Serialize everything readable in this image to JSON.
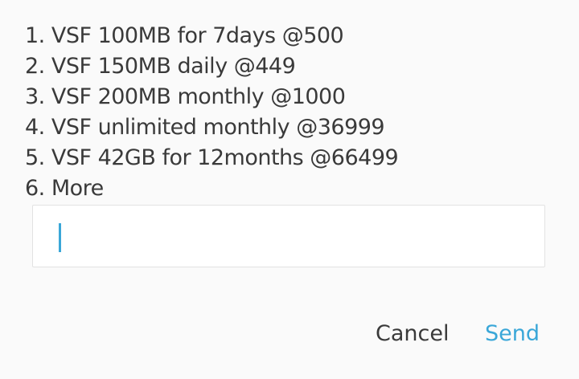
{
  "message": {
    "options": [
      "1. VSF 100MB for 7days @500",
      "2. VSF 150MB daily @449",
      "3. VSF 200MB monthly @1000",
      "4. VSF unlimited monthly @36999",
      "5. VSF 42GB for 12months @66499",
      "6. More"
    ]
  },
  "input": {
    "value": ""
  },
  "buttons": {
    "cancel_label": "Cancel",
    "send_label": "Send"
  },
  "colors": {
    "accent": "#3aa7d8",
    "text": "#3a3a3a",
    "background": "#fafafa"
  }
}
